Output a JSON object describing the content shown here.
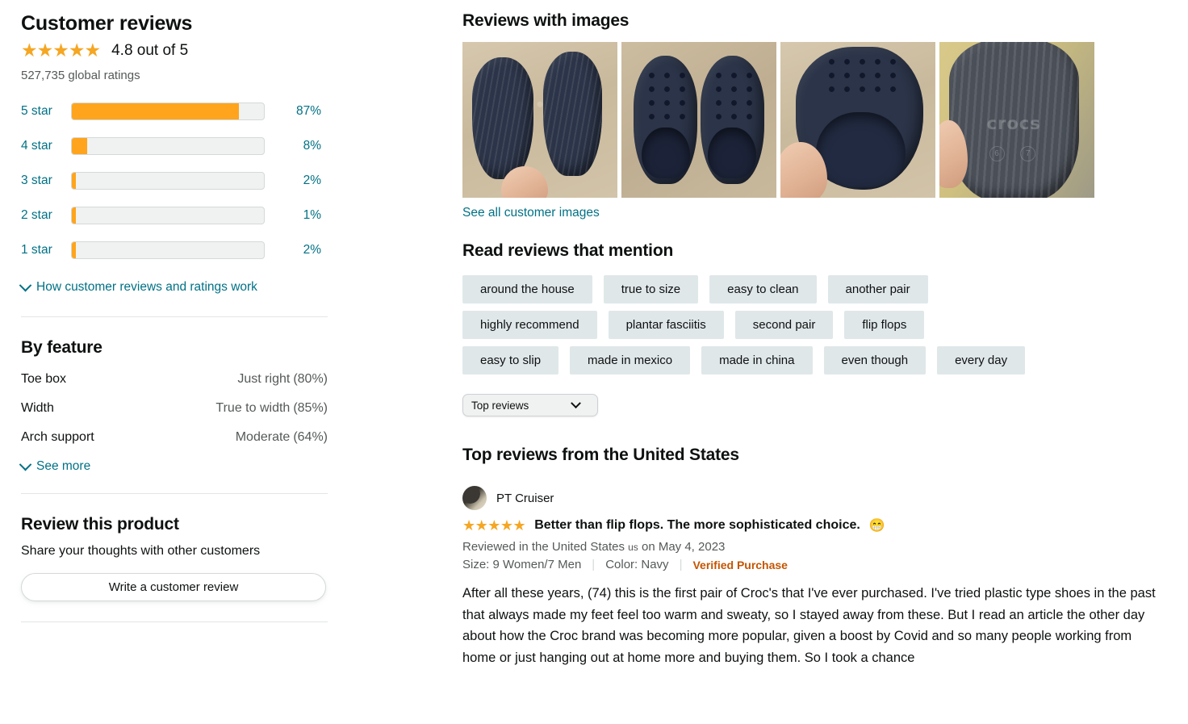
{
  "left": {
    "heading": "Customer reviews",
    "stars_display": "★★★★★",
    "rating_text": "4.8 out of 5",
    "global_ratings": "527,735 global ratings",
    "histogram": [
      {
        "label": "5 star",
        "pct_label": "87%",
        "pct": 87
      },
      {
        "label": "4 star",
        "pct_label": "8%",
        "pct": 8
      },
      {
        "label": "3 star",
        "pct_label": "2%",
        "pct": 2
      },
      {
        "label": "2 star",
        "pct_label": "1%",
        "pct": 1
      },
      {
        "label": "1 star",
        "pct_label": "2%",
        "pct": 2
      }
    ],
    "how_reviews_work": "How customer reviews and ratings work",
    "by_feature_heading": "By feature",
    "features": [
      {
        "name": "Toe box",
        "value": "Just right",
        "pct": "(80%)"
      },
      {
        "name": "Width",
        "value": "True to width",
        "pct": "(85%)"
      },
      {
        "name": "Arch support",
        "value": "Moderate",
        "pct": "(64%)"
      }
    ],
    "see_more": "See more",
    "review_product_heading": "Review this product",
    "share_thoughts": "Share your thoughts with other customers",
    "write_review_button": "Write a customer review"
  },
  "right": {
    "images_heading": "Reviews with images",
    "thumbnails": [
      {
        "alt": "navy crocs soles held in hand on carpet"
      },
      {
        "alt": "pair of navy crocs top view on carpet"
      },
      {
        "alt": "inside of navy croc held in hand"
      },
      {
        "alt": "croc outsole with crocs logo and size markings"
      }
    ],
    "see_all_images": "See all customer images",
    "mention_heading": "Read reviews that mention",
    "tags": [
      [
        "around the house",
        "true to size",
        "easy to clean",
        "another pair"
      ],
      [
        "highly recommend",
        "plantar fasciitis",
        "second pair",
        "flip flops"
      ],
      [
        "easy to slip",
        "made in mexico",
        "made in china",
        "even though",
        "every day"
      ]
    ],
    "sort_selected": "Top reviews",
    "top_reviews_heading": "Top reviews from the United States",
    "review": {
      "reviewer": "PT Cruiser",
      "stars_display": "★★★★★",
      "stars_value": 5,
      "title": "Better than flip flops. The more sophisticated choice.",
      "title_emoji": "😁",
      "reviewed_in": "Reviewed in the United States",
      "country_flag_text": "us",
      "date": "on May 4, 2023",
      "size_label": "Size: 9 Women/7 Men",
      "color_label": "Color: Navy",
      "verified": "Verified Purchase",
      "body": "After all these years, (74) this is the first pair of Croc's that I've ever purchased. I've tried plastic type shoes in the past that always made my feet feel too warm and sweaty, so I stayed away from these. But I read an article the other day about how the Croc brand was becoming more popular, given a boost by Covid and so many people working from home or just hanging out at home more and buying them. So I took a chance"
    }
  },
  "crocs_logo_text": "crocs",
  "sole_sizes": [
    "6",
    "7"
  ],
  "colors": {
    "star": "#F5A623",
    "bar_fill": "#FFA41C",
    "bar_track": "#F0F2F2",
    "link": "#007185",
    "verified": "#C45500",
    "tag_bg": "#DFE7E9",
    "text": "#0F1111",
    "muted": "#565959"
  }
}
